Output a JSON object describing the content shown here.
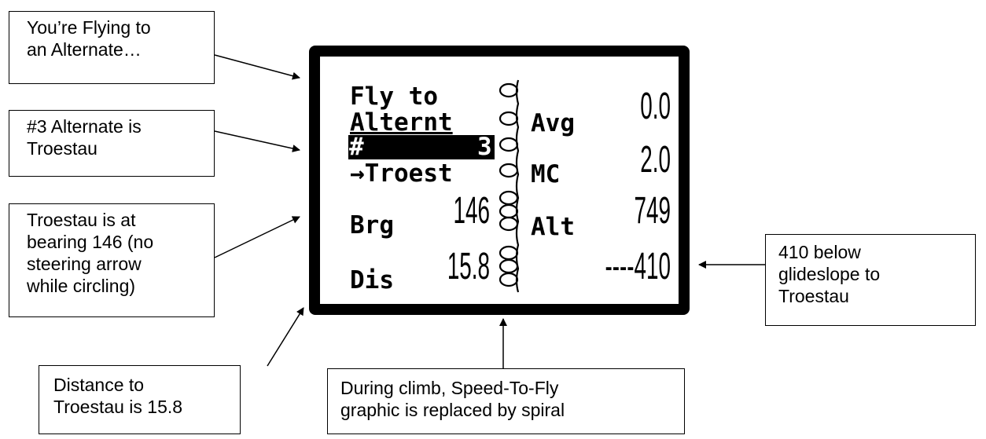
{
  "callouts": {
    "flying_alternate": [
      "You’re Flying to",
      "an Alternate…"
    ],
    "alternate_number": [
      "#3 Alternate is",
      "Troestau"
    ],
    "bearing": [
      "Troestau is at",
      "bearing 146 (no",
      "steering arrow",
      "while circling)"
    ],
    "distance": [
      "Distance to",
      "Troestau is 15.8"
    ],
    "climb": [
      "During climb, Speed-To-Fly",
      "graphic is replaced by spiral"
    ],
    "glideslope": [
      "410 below",
      "glideslope to",
      "Troestau"
    ]
  },
  "display": {
    "line1": "Fly to",
    "line2": "Alternt",
    "alt_hash": "#",
    "alt_num": "3",
    "dest": "→Troest",
    "brg_label": "Brg",
    "brg_value": "146",
    "dis_label": "Dis",
    "dis_value": "15.8",
    "avg_label": "Avg",
    "avg_value": "0.0",
    "mc_label": "MC",
    "mc_value": "2.0",
    "alt_label": "Alt",
    "alt_value": "749",
    "glide_value": "----410"
  }
}
